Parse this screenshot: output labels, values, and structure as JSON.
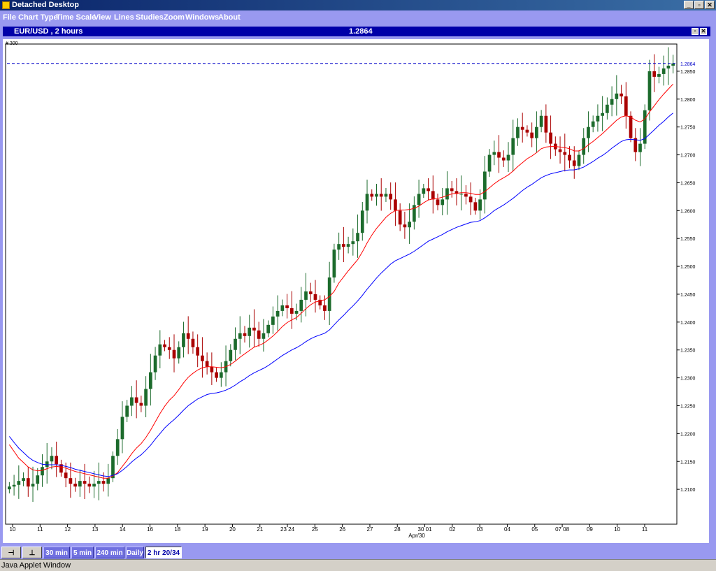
{
  "window": {
    "title": "Detached Desktop",
    "minimize": "_",
    "maximize": "▫",
    "close": "✕"
  },
  "menu": [
    "File",
    "Chart Type",
    "Time Scale",
    "View",
    "Lines",
    "Studies",
    "Zoom",
    "Windows",
    "About"
  ],
  "chart_header": {
    "symbol": "EUR/USD , 2 hours",
    "last_price": "1.2864",
    "restore": "▫",
    "close": "✕"
  },
  "toolbar": {
    "tools": [
      "⊣",
      "⊥"
    ],
    "timeframes": [
      "30 min",
      "5 min",
      "240 min",
      "Daily",
      "2 hr 20/34"
    ],
    "active": "2 hr 20/34"
  },
  "status": "Java Applet Window",
  "colors": {
    "up": "#1c6b2c",
    "down": "#aa0000",
    "ma_fast": "#ff0000",
    "ma_slow": "#0000ff",
    "last_price_line": "#0000c8"
  },
  "chart_data": {
    "type": "candlestick",
    "timeframe": "2 hours",
    "corner_label": "# 300",
    "last_price": 1.2864,
    "last_price_label": "1.2864",
    "ylim": [
      1.2045,
      1.2885
    ],
    "y_ticks": [
      "1.2100",
      "1.2150",
      "1.2200",
      "1.2250",
      "1.2300",
      "1.2350",
      "1.2400",
      "1.2450",
      "1.2500",
      "1.2550",
      "1.2600",
      "1.2650",
      "1.2700",
      "1.2750",
      "1.2800",
      "1.2850"
    ],
    "x_labels": [
      "10",
      "11",
      "12",
      "13",
      "14",
      "16",
      "18",
      "19",
      "20",
      "21",
      "23 24",
      "25",
      "26",
      "27",
      "28",
      "30 01",
      "02",
      "03",
      "04",
      "05",
      "07 08",
      "09",
      "10",
      "11"
    ],
    "x_sublabel": "Apr/30",
    "series": [
      {
        "close": [
          1.2105,
          1.2108,
          1.2115,
          1.212,
          1.2105,
          1.211,
          1.2125,
          1.214,
          1.215,
          1.216,
          1.2145,
          1.213,
          1.212,
          1.211,
          1.2105,
          1.2115,
          1.211,
          1.2105,
          1.211,
          1.2115,
          1.211,
          1.212,
          1.216,
          1.219,
          1.223,
          1.225,
          1.2265,
          1.2255,
          1.225,
          1.228,
          1.231,
          1.234,
          1.236,
          1.2355,
          1.235,
          1.2335,
          1.2355,
          1.238,
          1.237,
          1.2355,
          1.234,
          1.233,
          1.232,
          1.231,
          1.23,
          1.231,
          1.233,
          1.235,
          1.237,
          1.238,
          1.2375,
          1.239,
          1.2385,
          1.237,
          1.238,
          1.2395,
          1.241,
          1.242,
          1.243,
          1.2425,
          1.2415,
          1.242,
          1.244,
          1.2455,
          1.245,
          1.244,
          1.243,
          1.242,
          1.248,
          1.253,
          1.254,
          1.2535,
          1.254,
          1.2545,
          1.256,
          1.26,
          1.263,
          1.2625,
          1.263,
          1.2625,
          1.263,
          1.262,
          1.26,
          1.2575,
          1.257,
          1.258,
          1.261,
          1.263,
          1.264,
          1.2635,
          1.262,
          1.261,
          1.262,
          1.264,
          1.2635,
          1.263,
          1.263,
          1.2625,
          1.2615,
          1.26,
          1.262,
          1.267,
          1.27,
          1.2705,
          1.2695,
          1.269,
          1.27,
          1.273,
          1.275,
          1.2745,
          1.274,
          1.273,
          1.275,
          1.277,
          1.274,
          1.272,
          1.271,
          1.2705,
          1.27,
          1.269,
          1.268,
          1.27,
          1.273,
          1.275,
          1.276,
          1.277,
          1.2775,
          1.279,
          1.28,
          1.281,
          1.2805,
          1.277,
          1.273,
          1.2705,
          1.272,
          1.278,
          1.285,
          1.284,
          1.2845,
          1.2855,
          1.286,
          1.2864
        ]
      },
      {
        "name": "",
        "type": "line",
        "values": [
          1.218,
          1.2168,
          1.2156,
          1.2148,
          1.214,
          1.2135,
          1.2133,
          1.2134,
          1.2137,
          1.214,
          1.2141,
          1.214,
          1.2138,
          1.2135,
          1.2132,
          1.213,
          1.2128,
          1.2126,
          1.2124,
          1.2122,
          1.212,
          1.212,
          1.2124,
          1.213,
          1.2141,
          1.2152,
          1.2164,
          1.2174,
          1.2182,
          1.2193,
          1.2206,
          1.2221,
          1.2236,
          1.2249,
          1.226,
          1.2268,
          1.2279,
          1.2291,
          1.2301,
          1.2308,
          1.2314,
          1.2318,
          1.232,
          1.232,
          1.2319,
          1.2318,
          1.232,
          1.2324,
          1.233,
          1.2337,
          1.2343,
          1.2349,
          1.2355,
          1.2358,
          1.2362,
          1.2368,
          1.2375,
          1.2383,
          1.2392,
          1.2399,
          1.2404,
          1.2408,
          1.2416,
          1.2424,
          1.2431,
          1.2436,
          1.2438,
          1.244,
          1.2446,
          1.2455,
          1.247,
          1.2481,
          1.2492,
          1.2502,
          1.2512,
          1.2526,
          1.2542,
          1.2556,
          1.2568,
          1.2578,
          1.2588,
          1.2595,
          1.26,
          1.2601,
          1.2601,
          1.2602,
          1.2604,
          1.2608,
          1.2614,
          1.2619,
          1.2621,
          1.2622,
          1.2624,
          1.2627,
          1.263,
          1.2631,
          1.2632,
          1.2632,
          1.2631,
          1.2629,
          1.2629,
          1.2634,
          1.2641,
          1.2648,
          1.2654,
          1.2659,
          1.2664,
          1.2671,
          1.2679,
          1.2686,
          1.2693,
          1.2698,
          1.2704,
          1.2711,
          1.2714,
          1.2715,
          1.2715,
          1.2714,
          1.2713,
          1.2711,
          1.2707,
          1.2707,
          1.2711,
          1.2718,
          1.2724,
          1.2731,
          1.2738,
          1.2746,
          1.2754,
          1.2762,
          1.2768,
          1.277,
          1.2768,
          1.2762,
          1.2759,
          1.2764,
          1.2777,
          1.2788,
          1.2799,
          1.2809,
          1.2818,
          1.2827
        ]
      },
      {
        "name": "",
        "type": "line",
        "values": [
          1.2195,
          1.2184,
          1.2174,
          1.2166,
          1.2158,
          1.2152,
          1.2148,
          1.2145,
          1.2144,
          1.2144,
          1.2144,
          1.2143,
          1.2141,
          1.2139,
          1.2136,
          1.2134,
          1.2132,
          1.213,
          1.2128,
          1.2126,
          1.2124,
          1.2123,
          1.2125,
          1.2128,
          1.2134,
          1.2141,
          1.2149,
          1.2156,
          1.2162,
          1.217,
          1.2179,
          1.219,
          1.22,
          1.221,
          1.2218,
          1.2225,
          1.2233,
          1.2242,
          1.225,
          1.2256,
          1.2262,
          1.2266,
          1.227,
          1.2272,
          1.2273,
          1.2275,
          1.2278,
          1.2282,
          1.2287,
          1.2293,
          1.2298,
          1.2304,
          1.2309,
          1.2313,
          1.2317,
          1.2322,
          1.2328,
          1.2334,
          1.234,
          1.2345,
          1.235,
          1.2354,
          1.2359,
          1.2365,
          1.237,
          1.2374,
          1.2377,
          1.238,
          1.2386,
          1.2395,
          1.2404,
          1.2412,
          1.2421,
          1.2429,
          1.2438,
          1.2448,
          1.2459,
          1.2469,
          1.2479,
          1.2488,
          1.2496,
          1.2504,
          1.251,
          1.2514,
          1.2518,
          1.2522,
          1.2527,
          1.2533,
          1.2539,
          1.2545,
          1.2549,
          1.2553,
          1.2557,
          1.2562,
          1.2566,
          1.257,
          1.2573,
          1.2576,
          1.2579,
          1.258,
          1.2582,
          1.2587,
          1.2593,
          1.26,
          1.2605,
          1.261,
          1.2616,
          1.2622,
          1.2629,
          1.2636,
          1.2642,
          1.2647,
          1.2653,
          1.2659,
          1.2663,
          1.2666,
          1.2668,
          1.267,
          1.2672,
          1.2673,
          1.2673,
          1.2675,
          1.2678,
          1.2683,
          1.2688,
          1.2694,
          1.2699,
          1.2705,
          1.2712,
          1.2718,
          1.2724,
          1.2727,
          1.2728,
          1.2727,
          1.2726,
          1.2729,
          1.2737,
          1.2745,
          1.2753,
          1.276,
          1.2768,
          1.2775
        ]
      }
    ]
  }
}
